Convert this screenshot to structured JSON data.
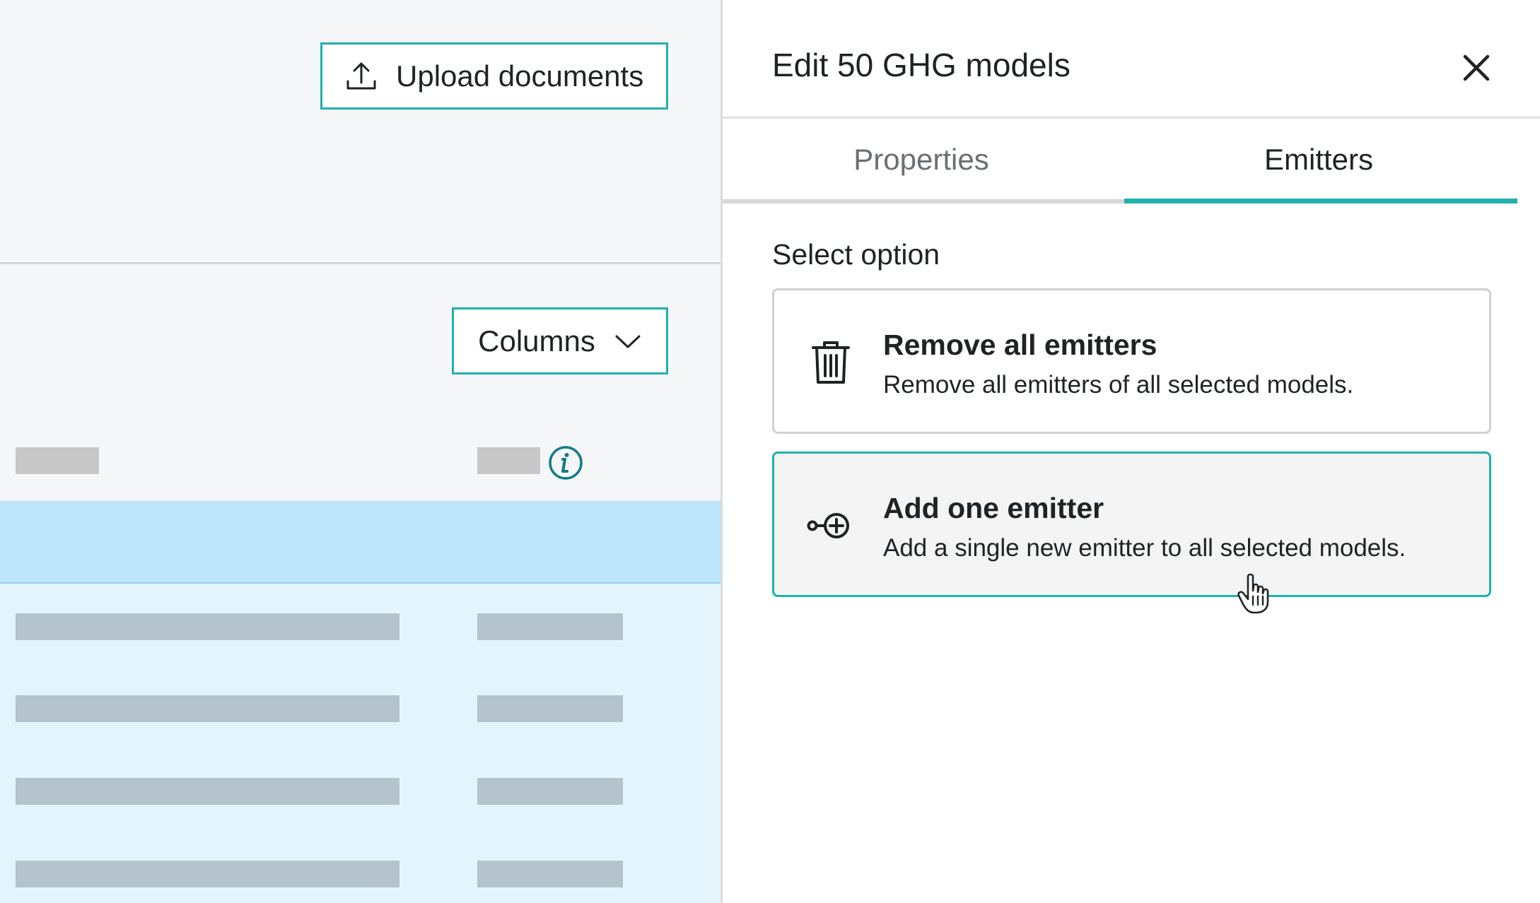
{
  "background_app": {
    "upload_button": {
      "label": "Upload documents",
      "icon": "upload-icon"
    },
    "columns_button": {
      "label": "Columns",
      "icon": "chevron-down-icon"
    },
    "info_icon": "info-icon",
    "skeleton_rows": 4
  },
  "panel": {
    "title": "Edit 50 GHG models",
    "close_icon": "close-icon",
    "tabs": [
      {
        "label": "Properties",
        "active": false
      },
      {
        "label": "Emitters",
        "active": true
      }
    ],
    "section_label": "Select option",
    "options": [
      {
        "title": "Remove all emitters",
        "description": "Remove all emitters of all selected models.",
        "icon": "trash-icon",
        "hovered": false
      },
      {
        "title": "Add one emitter",
        "description": "Add a single new emitter to all selected models.",
        "icon": "add-emitter-icon",
        "hovered": true
      }
    ]
  },
  "colors": {
    "accent": "#1fb2ae",
    "selected_row": "#bde5fc",
    "rows_background": "#e4f4fd",
    "text": "#1f2326",
    "muted_text": "#6b6f73"
  }
}
